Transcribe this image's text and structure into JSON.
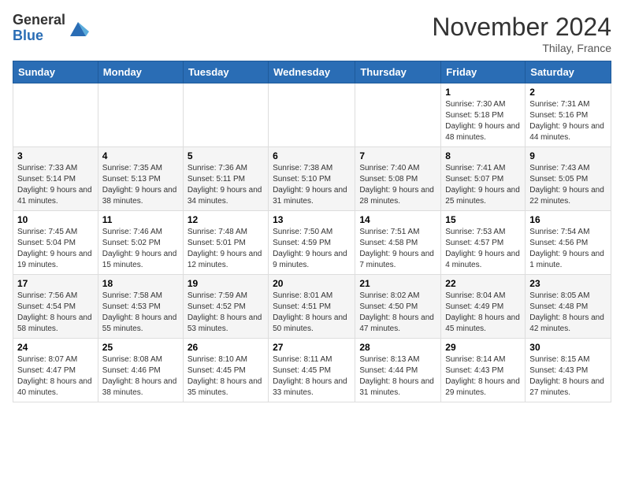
{
  "logo": {
    "general": "General",
    "blue": "Blue"
  },
  "header": {
    "month": "November 2024",
    "location": "Thilay, France"
  },
  "weekdays": [
    "Sunday",
    "Monday",
    "Tuesday",
    "Wednesday",
    "Thursday",
    "Friday",
    "Saturday"
  ],
  "weeks": [
    [
      {
        "day": "",
        "info": ""
      },
      {
        "day": "",
        "info": ""
      },
      {
        "day": "",
        "info": ""
      },
      {
        "day": "",
        "info": ""
      },
      {
        "day": "",
        "info": ""
      },
      {
        "day": "1",
        "info": "Sunrise: 7:30 AM\nSunset: 5:18 PM\nDaylight: 9 hours and 48 minutes."
      },
      {
        "day": "2",
        "info": "Sunrise: 7:31 AM\nSunset: 5:16 PM\nDaylight: 9 hours and 44 minutes."
      }
    ],
    [
      {
        "day": "3",
        "info": "Sunrise: 7:33 AM\nSunset: 5:14 PM\nDaylight: 9 hours and 41 minutes."
      },
      {
        "day": "4",
        "info": "Sunrise: 7:35 AM\nSunset: 5:13 PM\nDaylight: 9 hours and 38 minutes."
      },
      {
        "day": "5",
        "info": "Sunrise: 7:36 AM\nSunset: 5:11 PM\nDaylight: 9 hours and 34 minutes."
      },
      {
        "day": "6",
        "info": "Sunrise: 7:38 AM\nSunset: 5:10 PM\nDaylight: 9 hours and 31 minutes."
      },
      {
        "day": "7",
        "info": "Sunrise: 7:40 AM\nSunset: 5:08 PM\nDaylight: 9 hours and 28 minutes."
      },
      {
        "day": "8",
        "info": "Sunrise: 7:41 AM\nSunset: 5:07 PM\nDaylight: 9 hours and 25 minutes."
      },
      {
        "day": "9",
        "info": "Sunrise: 7:43 AM\nSunset: 5:05 PM\nDaylight: 9 hours and 22 minutes."
      }
    ],
    [
      {
        "day": "10",
        "info": "Sunrise: 7:45 AM\nSunset: 5:04 PM\nDaylight: 9 hours and 19 minutes."
      },
      {
        "day": "11",
        "info": "Sunrise: 7:46 AM\nSunset: 5:02 PM\nDaylight: 9 hours and 15 minutes."
      },
      {
        "day": "12",
        "info": "Sunrise: 7:48 AM\nSunset: 5:01 PM\nDaylight: 9 hours and 12 minutes."
      },
      {
        "day": "13",
        "info": "Sunrise: 7:50 AM\nSunset: 4:59 PM\nDaylight: 9 hours and 9 minutes."
      },
      {
        "day": "14",
        "info": "Sunrise: 7:51 AM\nSunset: 4:58 PM\nDaylight: 9 hours and 7 minutes."
      },
      {
        "day": "15",
        "info": "Sunrise: 7:53 AM\nSunset: 4:57 PM\nDaylight: 9 hours and 4 minutes."
      },
      {
        "day": "16",
        "info": "Sunrise: 7:54 AM\nSunset: 4:56 PM\nDaylight: 9 hours and 1 minute."
      }
    ],
    [
      {
        "day": "17",
        "info": "Sunrise: 7:56 AM\nSunset: 4:54 PM\nDaylight: 8 hours and 58 minutes."
      },
      {
        "day": "18",
        "info": "Sunrise: 7:58 AM\nSunset: 4:53 PM\nDaylight: 8 hours and 55 minutes."
      },
      {
        "day": "19",
        "info": "Sunrise: 7:59 AM\nSunset: 4:52 PM\nDaylight: 8 hours and 53 minutes."
      },
      {
        "day": "20",
        "info": "Sunrise: 8:01 AM\nSunset: 4:51 PM\nDaylight: 8 hours and 50 minutes."
      },
      {
        "day": "21",
        "info": "Sunrise: 8:02 AM\nSunset: 4:50 PM\nDaylight: 8 hours and 47 minutes."
      },
      {
        "day": "22",
        "info": "Sunrise: 8:04 AM\nSunset: 4:49 PM\nDaylight: 8 hours and 45 minutes."
      },
      {
        "day": "23",
        "info": "Sunrise: 8:05 AM\nSunset: 4:48 PM\nDaylight: 8 hours and 42 minutes."
      }
    ],
    [
      {
        "day": "24",
        "info": "Sunrise: 8:07 AM\nSunset: 4:47 PM\nDaylight: 8 hours and 40 minutes."
      },
      {
        "day": "25",
        "info": "Sunrise: 8:08 AM\nSunset: 4:46 PM\nDaylight: 8 hours and 38 minutes."
      },
      {
        "day": "26",
        "info": "Sunrise: 8:10 AM\nSunset: 4:45 PM\nDaylight: 8 hours and 35 minutes."
      },
      {
        "day": "27",
        "info": "Sunrise: 8:11 AM\nSunset: 4:45 PM\nDaylight: 8 hours and 33 minutes."
      },
      {
        "day": "28",
        "info": "Sunrise: 8:13 AM\nSunset: 4:44 PM\nDaylight: 8 hours and 31 minutes."
      },
      {
        "day": "29",
        "info": "Sunrise: 8:14 AM\nSunset: 4:43 PM\nDaylight: 8 hours and 29 minutes."
      },
      {
        "day": "30",
        "info": "Sunrise: 8:15 AM\nSunset: 4:43 PM\nDaylight: 8 hours and 27 minutes."
      }
    ]
  ]
}
